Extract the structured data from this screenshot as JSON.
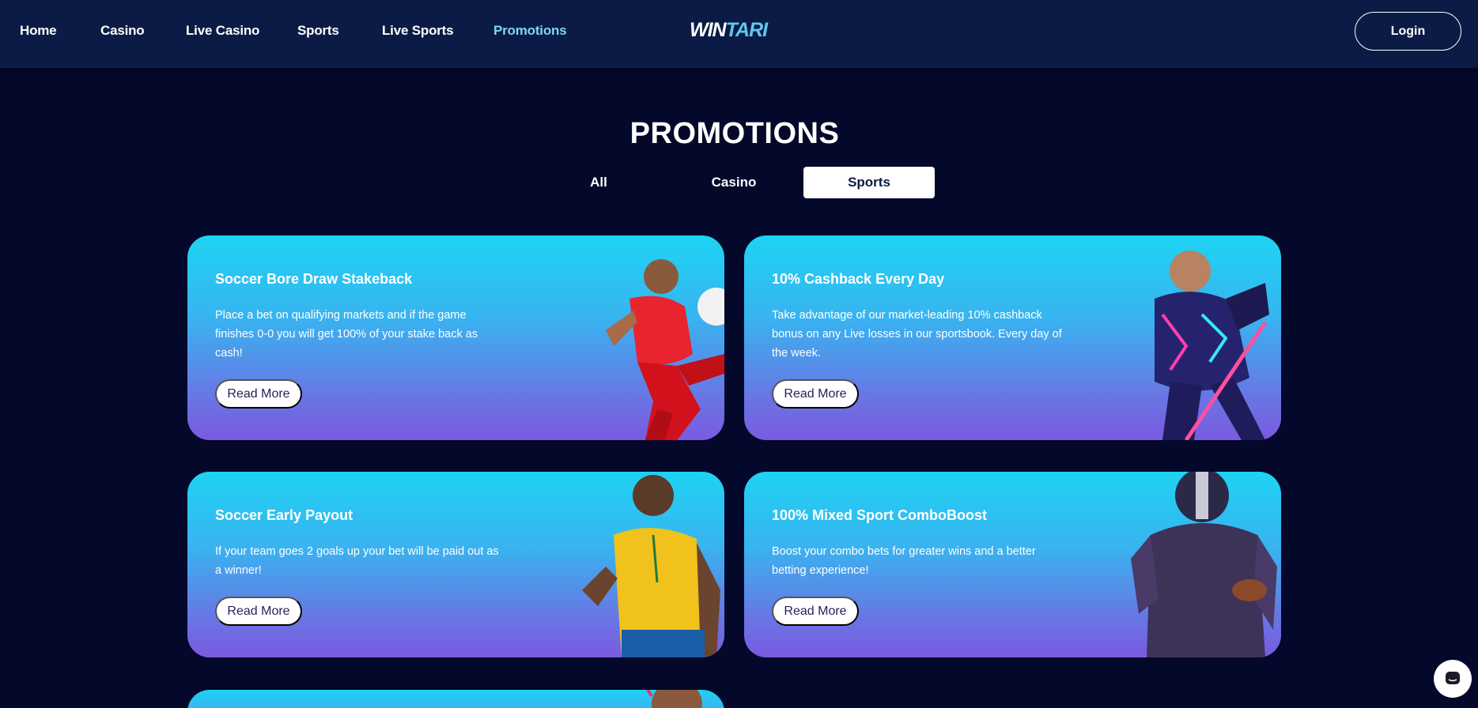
{
  "nav": {
    "items": [
      {
        "label": "Home",
        "active": false
      },
      {
        "label": "Casino",
        "active": false
      },
      {
        "label": "Live Casino",
        "active": false
      },
      {
        "label": "Sports",
        "active": false
      },
      {
        "label": "Live Sports",
        "active": false
      },
      {
        "label": "Promotions",
        "active": true
      }
    ],
    "logo_part1": "WIN",
    "logo_part2": "TARI",
    "login_label": "Login"
  },
  "page_title": "PROMOTIONS",
  "tabs": [
    {
      "label": "All",
      "active": false
    },
    {
      "label": "Casino",
      "active": false
    },
    {
      "label": "Sports",
      "active": true
    }
  ],
  "cards": [
    {
      "title": "Soccer Bore Draw Stakeback",
      "description": "Place a bet on qualifying markets and if the game finishes 0-0 you will get 100% of your stake back as cash!",
      "button": "Read More",
      "image": "soccer-player-kicking"
    },
    {
      "title": "10% Cashback Every Day",
      "description": "Take advantage of our market-leading 10% cashback bonus on any Live losses in our sportsbook. Every day of the week.",
      "button": "Read More",
      "image": "hockey-player"
    },
    {
      "title": "Soccer Early Payout",
      "description": "If your team goes 2 goals up your bet will be paid out as a winner!",
      "button": "Read More",
      "image": "soccer-player-thumbs-up"
    },
    {
      "title": "100% Mixed Sport ComboBoost",
      "description": "Boost your combo bets for greater wins and a better betting experience!",
      "button": "Read More",
      "image": "american-football-player"
    }
  ],
  "colors": {
    "background": "#04082a",
    "header": "#0b1b45",
    "active_nav": "#7ed6f2",
    "card_top": "#1ed3f3",
    "card_bottom": "#7a5ae0"
  },
  "chat": {
    "icon": "chat-icon"
  }
}
